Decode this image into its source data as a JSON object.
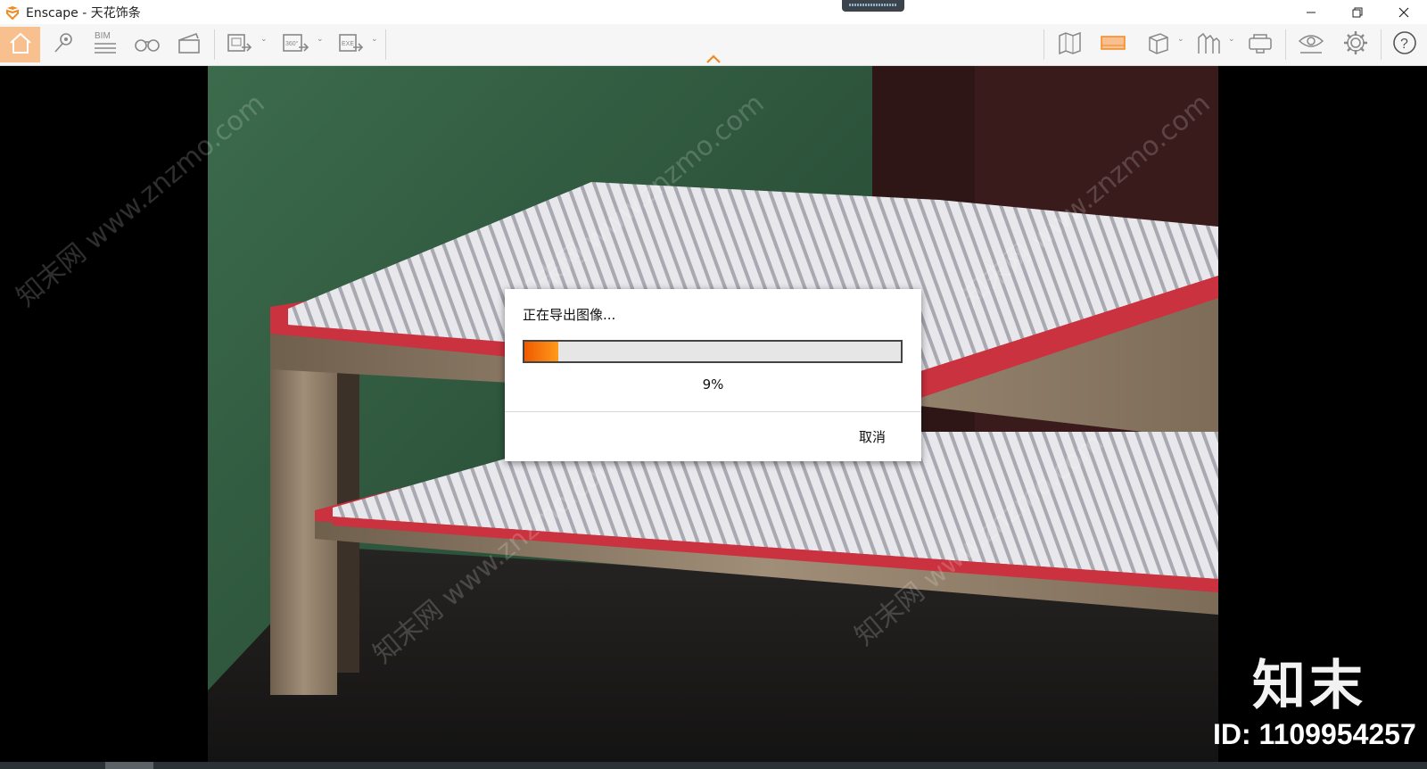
{
  "window": {
    "app_name": "Enscape",
    "title": "Enscape - 天花饰条"
  },
  "toolbar": {
    "left_items": [
      {
        "name": "home-icon",
        "active": true
      },
      {
        "name": "locate-icon"
      },
      {
        "name": "bim-icon",
        "label": "BIM"
      },
      {
        "name": "binoculars-icon"
      },
      {
        "name": "clapperboard-icon"
      }
    ],
    "export_items": [
      {
        "name": "screenshot-export-icon"
      },
      {
        "name": "panorama-export-icon",
        "label": "360°"
      },
      {
        "name": "exe-export-icon",
        "label": "EXE"
      }
    ],
    "right_items": [
      {
        "name": "map-icon"
      },
      {
        "name": "orange-panel-icon"
      },
      {
        "name": "cube-icon"
      },
      {
        "name": "asset-library-icon"
      },
      {
        "name": "vr-headset-icon"
      },
      {
        "name": "eye-settings-icon"
      },
      {
        "name": "gear-icon"
      },
      {
        "name": "help-icon"
      }
    ]
  },
  "dialog": {
    "title": "正在导出图像...",
    "progress": 0.09,
    "percent_label": "9%",
    "cancel_label": "取消"
  },
  "watermark": {
    "logo_text": "知末",
    "id_text": "ID: 1109954257",
    "site_text": "知末网 www.znzmo.com"
  },
  "colors": {
    "accent": "#f08a24",
    "active_tab_bg": "#f8c08f",
    "wall_green": "#2f5a40",
    "wall_maroon": "#3a1818",
    "red_base": "#c8323c",
    "wood": "#8b7a66"
  }
}
